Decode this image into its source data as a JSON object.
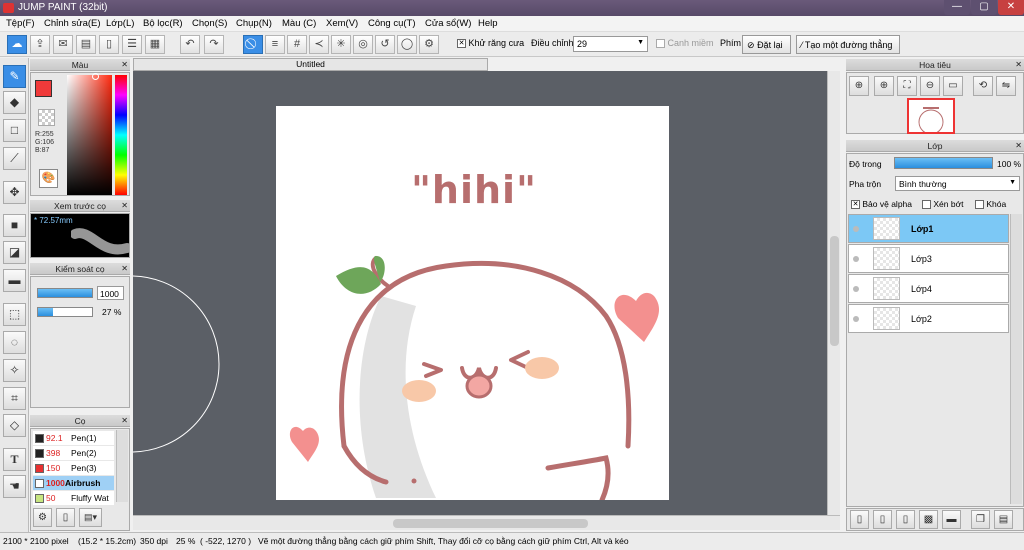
{
  "app": {
    "title": "JUMP PAINT (32bit)"
  },
  "menu": [
    "Tệp(F)",
    "Chỉnh sửa(E)",
    "Lớp(L)",
    "Bộ lọc(R)",
    "Chọn(S)",
    "Chụp(N)",
    "Màu (C)",
    "Xem(V)",
    "Công cụ(T)",
    "Cửa sổ(W)",
    "Help"
  ],
  "toolbar": {
    "antialias": "Khử răng cưa",
    "adjust": "Điều chỉnh",
    "adjust_value": "29",
    "edge": "Canh miềm",
    "key": "Phím",
    "reset": "Đặt lại",
    "straight": "Tạo một đường thẳng"
  },
  "panels": {
    "color": "Màu",
    "preview": "Xem trước cọ",
    "preview_size": "* 72.57mm",
    "brushctl": "Kiểm soát cọ",
    "brushctl_size": "1000",
    "brushctl_opacity": "27 %",
    "brush": "Cọ",
    "navigator": "Hoa tiêu",
    "layer": "Lớp"
  },
  "color": {
    "r": "R:255",
    "g": "G:106",
    "b": "B:87",
    "fg": "#f03a3a"
  },
  "brushes": [
    {
      "size": "92.1",
      "name": "Pen(1)",
      "color": "#222222"
    },
    {
      "size": "398",
      "name": "Pen(2)",
      "color": "#222222"
    },
    {
      "size": "150",
      "name": "Pen(3)",
      "color": "#e83030"
    },
    {
      "size": "1000",
      "name": "Airbrush",
      "color": "#ffffff"
    },
    {
      "size": "50",
      "name": "Fluffy Wat",
      "color": "#c8e680"
    }
  ],
  "document": {
    "tab": "Untitled",
    "art_text": "\"hihi\""
  },
  "layers": {
    "opacity_label": "Độ trong",
    "opacity": "100 %",
    "blend_label": "Pha trộn",
    "blend": "Bình thường",
    "protect_alpha": "Bảo vệ alpha",
    "clip": "Xén bớt",
    "lock": "Khóa",
    "items": [
      "Lớp1",
      "Lớp3",
      "Lớp4",
      "Lớp2"
    ]
  },
  "status": {
    "size": "2100 * 2100 pixel",
    "cm": "(15.2 * 15.2cm)",
    "dpi": "350 dpi",
    "zoom": "25 %",
    "coords": "( -522, 1270 )",
    "hint": "Vẽ một đường thẳng bằng cách giữ phím Shift, Thay đổi cỡ cọ bằng cách giữ phím Ctrl, Alt và kéo"
  }
}
